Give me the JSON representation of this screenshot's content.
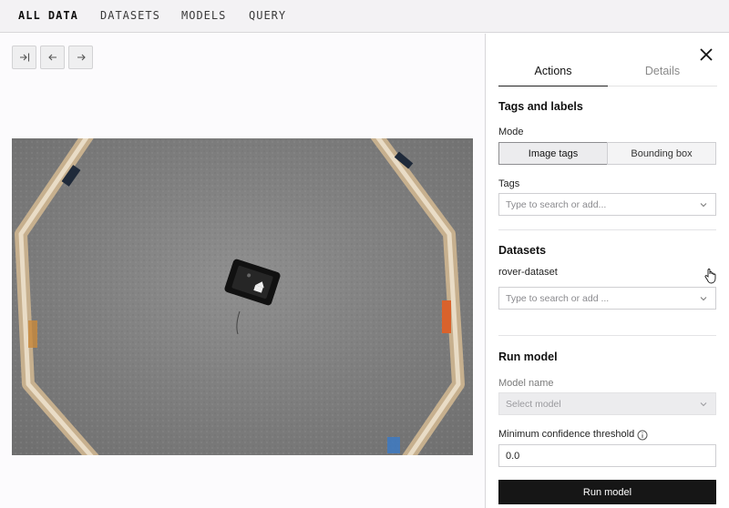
{
  "topnav": {
    "items": [
      "ALL DATA",
      "DATASETS",
      "MODELS",
      "QUERY"
    ]
  },
  "viewer": {
    "controls": [
      "collapse-icon",
      "arrow-left-icon",
      "arrow-right-icon"
    ],
    "image": "top-down photo of a small rover on grey carpet inside an octagonal wooden track"
  },
  "panel": {
    "tabs": [
      "Actions",
      "Details"
    ],
    "tags_labels": {
      "title": "Tags and labels",
      "mode_label": "Mode",
      "mode_options": [
        "Image tags",
        "Bounding box"
      ],
      "tags_label": "Tags",
      "tags_placeholder": "Type to search or add..."
    },
    "datasets": {
      "title": "Datasets",
      "dataset_name": "rover-dataset",
      "placeholder": "Type to search or add ..."
    },
    "run_model": {
      "title": "Run model",
      "model_name_label": "Model name",
      "model_placeholder": "Select model",
      "threshold_label": "Minimum confidence threshold",
      "threshold_value": "0.0",
      "button": "Run model"
    }
  }
}
